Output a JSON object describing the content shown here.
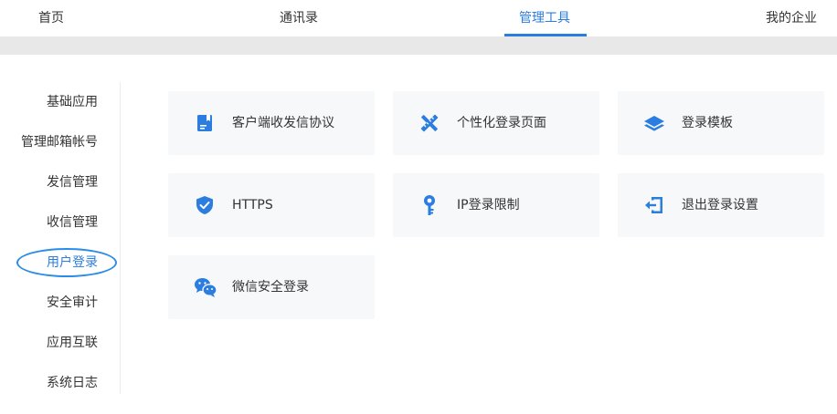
{
  "topnav": {
    "tabs": [
      {
        "label": "首页"
      },
      {
        "label": "通讯录"
      },
      {
        "label": "管理工具"
      },
      {
        "label": "我的企业"
      }
    ],
    "active_index": 2
  },
  "sidebar": {
    "items": [
      {
        "label": "基础应用"
      },
      {
        "label": "管理邮箱帐号"
      },
      {
        "label": "发信管理"
      },
      {
        "label": "收信管理"
      },
      {
        "label": "用户登录"
      },
      {
        "label": "安全审计"
      },
      {
        "label": "应用互联"
      },
      {
        "label": "系统日志"
      }
    ],
    "active_index": 4
  },
  "cards": [
    {
      "label": "客户端收发信协议",
      "icon": "book-icon"
    },
    {
      "label": "个性化登录页面",
      "icon": "pencil-ruler-icon"
    },
    {
      "label": "登录模板",
      "icon": "layers-icon"
    },
    {
      "label": "HTTPS",
      "icon": "shield-check-icon"
    },
    {
      "label": "IP登录限制",
      "icon": "key-icon"
    },
    {
      "label": "退出登录设置",
      "icon": "logout-icon"
    },
    {
      "label": "微信安全登录",
      "icon": "wechat-icon"
    }
  ],
  "colors": {
    "accent": "#2b7ddf",
    "card_bg": "#f6f8fa",
    "band": "#e8e8e8",
    "text": "#333333"
  }
}
